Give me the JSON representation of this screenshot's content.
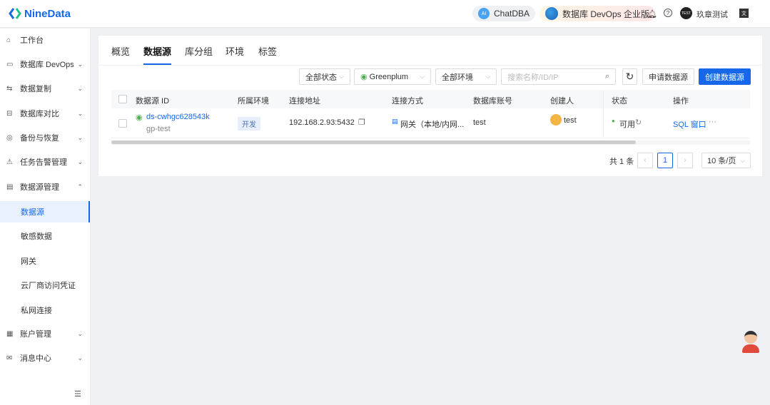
{
  "header": {
    "logo": "NineData",
    "chatdba": "ChatDBA",
    "devops": "数据库 DevOps 企业版",
    "user": "玖章测试",
    "avatar_text": "TEST"
  },
  "sidebar": {
    "items": [
      {
        "label": "工作台",
        "icon": "home-icon"
      },
      {
        "label": "数据库 DevOps",
        "icon": "devops-icon",
        "chevron": "down"
      },
      {
        "label": "数据复制",
        "icon": "replication-icon",
        "chevron": "down"
      },
      {
        "label": "数据库对比",
        "icon": "compare-icon",
        "chevron": "down"
      },
      {
        "label": "备份与恢复",
        "icon": "backup-icon",
        "chevron": "down"
      },
      {
        "label": "任务告警管理",
        "icon": "alert-icon",
        "chevron": "down"
      },
      {
        "label": "数据源管理",
        "icon": "datasource-icon",
        "chevron": "up"
      },
      {
        "label": "数据源",
        "sub": true,
        "active": true
      },
      {
        "label": "敏感数据",
        "sub": true
      },
      {
        "label": "网关",
        "sub": true
      },
      {
        "label": "云厂商访问凭证",
        "sub": true
      },
      {
        "label": "私网连接",
        "sub": true
      },
      {
        "label": "账户管理",
        "icon": "account-icon",
        "chevron": "down"
      },
      {
        "label": "消息中心",
        "icon": "message-icon",
        "chevron": "down"
      }
    ]
  },
  "tabs": [
    "概览",
    "数据源",
    "库分组",
    "环境",
    "标签"
  ],
  "filters": {
    "status": "全部状态",
    "db_type": "Greenplum",
    "env": "全部环境",
    "search_placeholder": "搜索名称/ID/IP"
  },
  "buttons": {
    "apply": "申请数据源",
    "create": "创建数据源"
  },
  "table": {
    "columns": [
      "数据源 ID",
      "所属环境",
      "连接地址",
      "连接方式",
      "数据库账号",
      "创建人",
      "状态",
      "操作"
    ],
    "rows": [
      {
        "id": "ds-cwhgc628543k",
        "name": "gp-test",
        "env": "开发",
        "address": "192.168.2.93:5432",
        "conn": "网关（本地/内网...",
        "account": "test",
        "creator": "test",
        "status": "可用",
        "action": "SQL 窗口",
        "more": "···"
      }
    ]
  },
  "pagination": {
    "total": "共 1 条",
    "page": "1",
    "page_size": "10 条/页"
  }
}
